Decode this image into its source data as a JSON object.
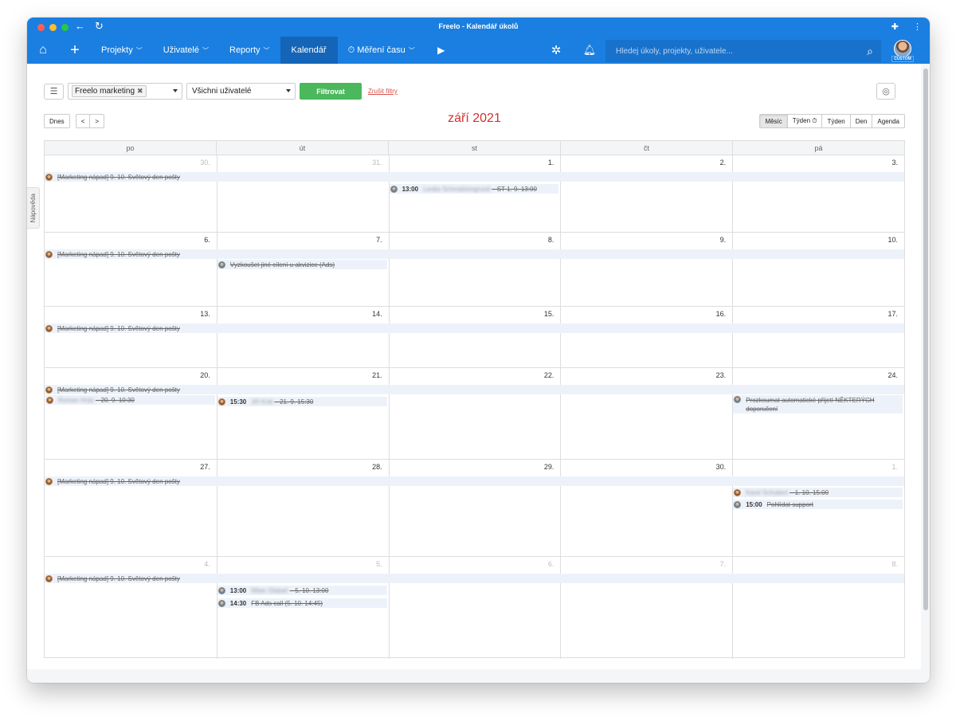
{
  "window": {
    "title": "Freelo - Kalendář úkolů"
  },
  "navbar": {
    "items": [
      {
        "label": "Projekty",
        "dropdown": true
      },
      {
        "label": "Uživatelé",
        "dropdown": true
      },
      {
        "label": "Reporty",
        "dropdown": true
      },
      {
        "label": "Kalendář",
        "dropdown": false,
        "active": true
      },
      {
        "label": "⏱ Měření času",
        "dropdown": true
      }
    ],
    "search_placeholder": "Hledej úkoly, projekty, uživatele...",
    "avatar_tag": "CUSTOM"
  },
  "filters": {
    "project_chip": "Freelo marketing",
    "users_select": "Všichni uživatelé",
    "filter_button": "Filtrovat",
    "cancel_link": "Zrušit filtry"
  },
  "toolbar": {
    "today": "Dnes",
    "prev": "<",
    "next": ">",
    "month_title": "září 2021",
    "views": [
      "Měsíc",
      "Týden ⏱",
      "Týden",
      "Den",
      "Agenda"
    ],
    "active_view": "Měsíc"
  },
  "help_tab": "Nápověda",
  "calendar": {
    "weekdays": [
      "po",
      "út",
      "st",
      "čt",
      "pá"
    ],
    "weeks": [
      {
        "days": [
          {
            "n": "30.",
            "other": true
          },
          {
            "n": "31.",
            "other": true
          },
          {
            "n": "1."
          },
          {
            "n": "2."
          },
          {
            "n": "3."
          }
        ]
      },
      {
        "days": [
          {
            "n": "6."
          },
          {
            "n": "7."
          },
          {
            "n": "8."
          },
          {
            "n": "9."
          },
          {
            "n": "10."
          }
        ]
      },
      {
        "days": [
          {
            "n": "13."
          },
          {
            "n": "14."
          },
          {
            "n": "15."
          },
          {
            "n": "16."
          },
          {
            "n": "17."
          }
        ]
      },
      {
        "days": [
          {
            "n": "20."
          },
          {
            "n": "21."
          },
          {
            "n": "22."
          },
          {
            "n": "23."
          },
          {
            "n": "24."
          }
        ]
      },
      {
        "days": [
          {
            "n": "27."
          },
          {
            "n": "28."
          },
          {
            "n": "29."
          },
          {
            "n": "30."
          },
          {
            "n": "1.",
            "other": true
          }
        ]
      },
      {
        "days": [
          {
            "n": "4.",
            "other": true
          },
          {
            "n": "5.",
            "other": true
          },
          {
            "n": "6.",
            "other": true
          },
          {
            "n": "7.",
            "other": true
          },
          {
            "n": "8.",
            "other": true
          }
        ]
      }
    ],
    "events": {
      "recurring": "[Marketing nápad] 9. 10. Světový den pošty",
      "w0_st": {
        "time": "13:00",
        "blur": "Lenka Schmalzengrund",
        "text": "– ST 1. 9. 13:00"
      },
      "w1_ut": {
        "text": "Vyzkoušet jiné cílení u akvizice (Ads)"
      },
      "w3_po": {
        "blur": "Roman Hráz",
        "text": "– 20. 9. 10:30"
      },
      "w3_ut": {
        "time": "15:30",
        "blur": "Jiří Král",
        "text": "– 21. 9. 15:30"
      },
      "w3_pa": {
        "text": "Prozkoumat automatické přijetí NĚKTERÝCH doporučení"
      },
      "w4_pa1": {
        "blur": "Karel Schubert",
        "text": "– 1. 10. 15:00"
      },
      "w4_pa2": {
        "time": "15:00",
        "text": "Pohlídat support"
      },
      "w5_ut1": {
        "time": "13:00",
        "blur": "Milan Dlabač",
        "text": "– 5. 10. 13:00"
      },
      "w5_ut2": {
        "time": "14:30",
        "text": "FB Ads call (5. 10. 14:45)"
      }
    }
  }
}
